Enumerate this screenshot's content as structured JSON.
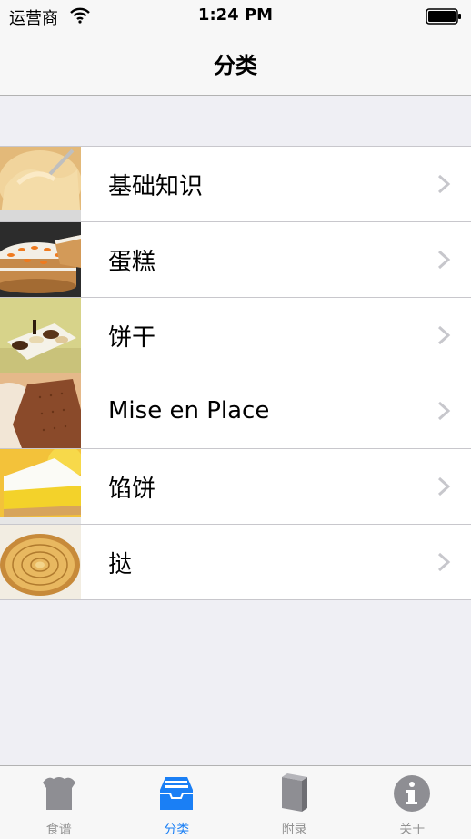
{
  "status_bar": {
    "carrier": "运营商",
    "time": "1:24 PM"
  },
  "nav": {
    "title": "分类"
  },
  "categories": [
    {
      "label": "基础知识",
      "image": "cream-bowl-image"
    },
    {
      "label": "蛋糕",
      "image": "carrot-cake-image"
    },
    {
      "label": "饼干",
      "image": "biscuits-image"
    },
    {
      "label": "Mise en Place",
      "image": "graham-cracker-image"
    },
    {
      "label": "馅饼",
      "image": "lemon-meringue-pie-image"
    },
    {
      "label": "挞",
      "image": "apple-tart-image"
    }
  ],
  "tabs": [
    {
      "label": "食谱",
      "icon": "chef-hat-icon",
      "active": false
    },
    {
      "label": "分类",
      "icon": "tray-icon",
      "active": true
    },
    {
      "label": "附录",
      "icon": "book-icon",
      "active": false
    },
    {
      "label": "关于",
      "icon": "info-icon",
      "active": false
    }
  ],
  "colors": {
    "accent": "#1a7ff5",
    "inactive": "#929292"
  }
}
